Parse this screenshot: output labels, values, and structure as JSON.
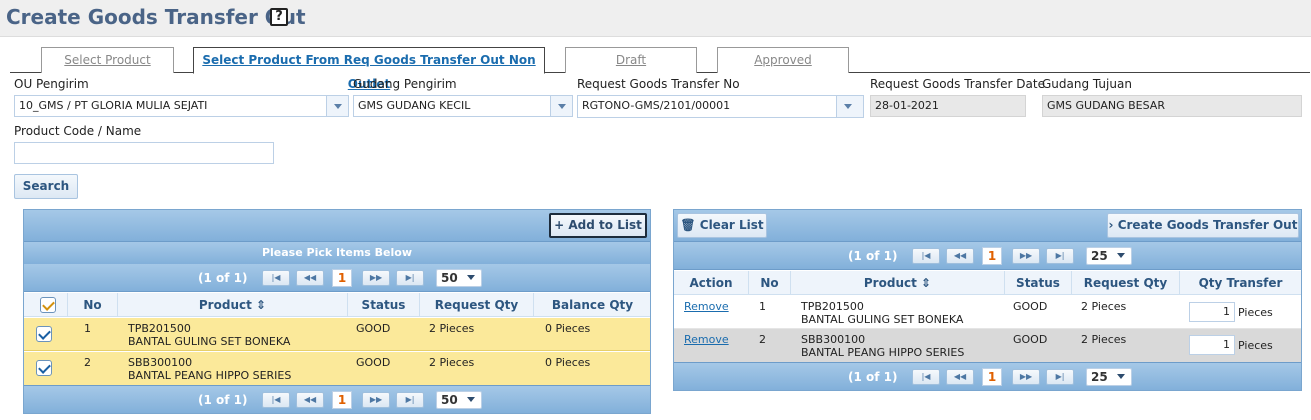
{
  "header": {
    "title": "Create Goods Transfer Out",
    "help": "?"
  },
  "tabs": [
    {
      "label": "Select Product"
    },
    {
      "label": "Select Product From Req Goods Transfer Out Non Outlet"
    },
    {
      "label": "Draft"
    },
    {
      "label": "Approved"
    }
  ],
  "form": {
    "ou_label": "OU Pengirim",
    "ou_value": "10_GMS / PT GLORIA MULIA SEJATI",
    "gudang_label": "Gudang Pengirim",
    "gudang_value": "GMS GUDANG KECIL",
    "req_no_label": "Request Goods Transfer No",
    "req_no_value": "RGTONO-GMS/2101/00001",
    "req_date_label": "Request Goods Transfer Date",
    "req_date_value": "28-01-2021",
    "tujuan_label": "Gudang Tujuan",
    "tujuan_value": "GMS GUDANG BESAR",
    "product_label": "Product Code / Name",
    "product_value": "",
    "search_label": "Search"
  },
  "left_panel": {
    "add_label": "Add to List",
    "caption": "Please Pick Items Below",
    "pager": {
      "info": "(1 of 1)",
      "page": "1",
      "size": "50",
      "first": "|◀",
      "prev": "◀◀",
      "next": "▶▶",
      "last": "▶|"
    },
    "columns": [
      "No",
      "Product",
      "Status",
      "Request Qty",
      "Balance Qty"
    ],
    "rows": [
      {
        "no": "1",
        "code": "TPB201500",
        "name": "BANTAL GULING SET BONEKA",
        "status": "GOOD",
        "req_qty": "2 Pieces",
        "bal_qty": "0 Pieces"
      },
      {
        "no": "2",
        "code": "SBB300100",
        "name": "BANTAL PEANG HIPPO SERIES",
        "status": "GOOD",
        "req_qty": "2 Pieces",
        "bal_qty": "0 Pieces"
      }
    ]
  },
  "right_panel": {
    "clear_label": "Clear List",
    "create_label": "Create Goods Transfer Out",
    "pager": {
      "info": "(1 of 1)",
      "page": "1",
      "size": "25",
      "first": "|◀",
      "prev": "◀◀",
      "next": "▶▶",
      "last": "▶|"
    },
    "columns": [
      "Action",
      "No",
      "Product",
      "Status",
      "Request Qty",
      "Qty Transfer"
    ],
    "rows": [
      {
        "action": "Remove",
        "no": "1",
        "code": "TPB201500",
        "name": "BANTAL GULING SET BONEKA",
        "status": "GOOD",
        "req_qty": "2 Pieces",
        "qty": "1",
        "unit": "Pieces"
      },
      {
        "action": "Remove",
        "no": "2",
        "code": "SBB300100",
        "name": "BANTAL PEANG HIPPO SERIES",
        "status": "GOOD",
        "req_qty": "2 Pieces",
        "qty": "1",
        "unit": "Pieces"
      }
    ]
  },
  "colors": {
    "title": "#4a6487",
    "bar": "#82b0da",
    "selected_row": "#fbe99a",
    "alt_row": "#d9d9d9",
    "link": "#1a6cae"
  }
}
